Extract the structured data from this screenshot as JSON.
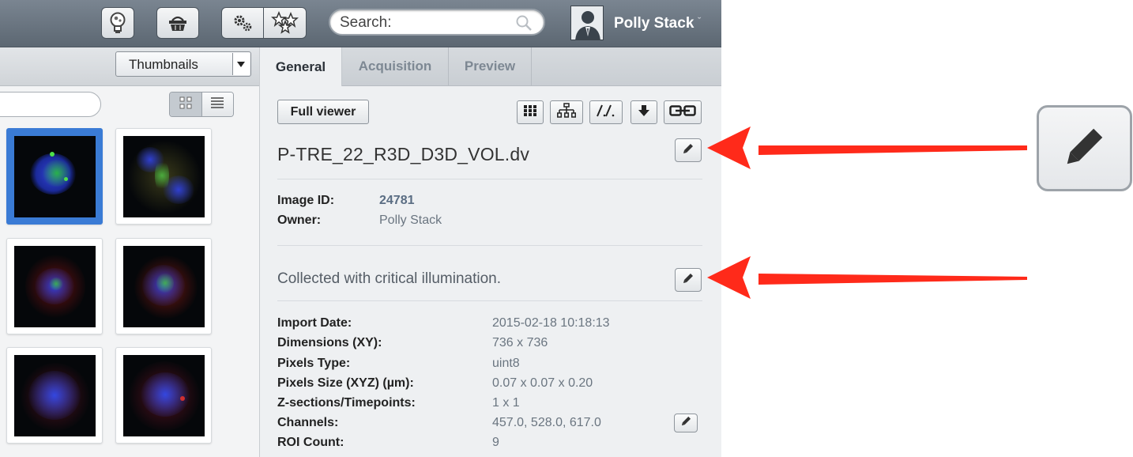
{
  "topbar": {
    "search_placeholder": "Search:",
    "user_name": "Polly Stack",
    "user_caret": "ˇ",
    "icons": [
      "lightbulb-icon",
      "basket-icon",
      "settings-gears-icon",
      "scripts-stars-icon",
      "search-icon",
      "user-avatar-icon",
      "chevron-down-icon"
    ]
  },
  "left_panel": {
    "view_select": "Thumbnails",
    "thumbnails_count": 6,
    "selected_thumbnail": 1
  },
  "right_panel": {
    "tabs": [
      "General",
      "Acquisition",
      "Preview"
    ],
    "active_tab": "General",
    "full_viewer_label": "Full viewer",
    "tool_icons": [
      "grid-icon",
      "hierarchy-icon",
      "link-path-icon",
      "download-icon",
      "chain-link-icon"
    ],
    "file_name": "P-TRE_22_R3D_D3D_VOL.dv",
    "image_id_label": "Image ID:",
    "image_id_value": "24781",
    "owner_label": "Owner:",
    "owner_value": "Polly Stack",
    "description": "Collected with critical illumination.",
    "metadata": [
      {
        "label": "Import Date:",
        "value": "2015-02-18 10:18:13"
      },
      {
        "label": "Dimensions (XY):",
        "value": "736 x 736"
      },
      {
        "label": "Pixels Type:",
        "value": "uint8"
      },
      {
        "label": "Pixels Size (XYZ) (µm):",
        "value": "0.07 x 0.07 x 0.20"
      },
      {
        "label": "Z-sections/Timepoints:",
        "value": "1 x 1"
      },
      {
        "label": "Channels:",
        "value": "457.0, 528.0, 617.0"
      },
      {
        "label": "ROI Count:",
        "value": "9"
      }
    ]
  },
  "annotation": {
    "arrow_color": "#ff2a1a",
    "zoom_icon": "pencil-icon"
  }
}
